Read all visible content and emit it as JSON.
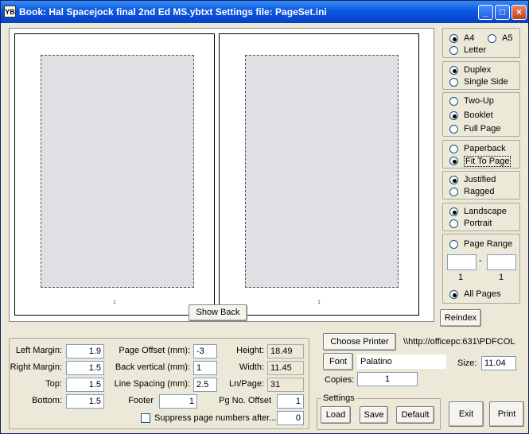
{
  "titlebar": {
    "icon": "YB",
    "title": "Book: Hal Spacejock final 2nd Ed MS.ybtxt  Settings file: PageSet.ini",
    "minimize": "_",
    "maximize": "□",
    "close": "×"
  },
  "preview": {
    "left_page_number": "1",
    "right_page_number": "1",
    "show_back_label": "Show Back"
  },
  "paper": {
    "options": [
      {
        "label": "A4",
        "selected": true
      },
      {
        "label": "A5",
        "selected": false
      },
      {
        "label": "Letter",
        "selected": false
      }
    ]
  },
  "sides": {
    "options": [
      {
        "label": "Duplex",
        "selected": true
      },
      {
        "label": "Single Side",
        "selected": false
      }
    ]
  },
  "layout": {
    "options": [
      {
        "label": "Two-Up",
        "selected": false
      },
      {
        "label": "Booklet",
        "selected": true
      },
      {
        "label": "Full Page",
        "selected": false
      }
    ]
  },
  "fit": {
    "options": [
      {
        "label": "Paperback",
        "selected": false
      },
      {
        "label": "Fit To Page",
        "selected": true
      }
    ]
  },
  "justify": {
    "options": [
      {
        "label": "Justified",
        "selected": true
      },
      {
        "label": "Ragged",
        "selected": false
      }
    ]
  },
  "orientation": {
    "options": [
      {
        "label": "Landscape",
        "selected": true
      },
      {
        "label": "Portrait",
        "selected": false
      }
    ]
  },
  "range": {
    "page_range_label": "Page Range",
    "page_range_selected": false,
    "from_value": "",
    "separator": "-",
    "to_value": "",
    "from_hint": "1",
    "to_hint": "1",
    "all_pages_label": "All Pages",
    "all_pages_selected": true
  },
  "reindex_label": "Reindex",
  "margins": {
    "left_label": "Left Margin:",
    "left_value": "1.9",
    "right_label": "Right Margin:",
    "right_value": "1.5",
    "top_label": "Top:",
    "top_value": "1.5",
    "bottom_label": "Bottom:",
    "bottom_value": "1.5"
  },
  "offsets": {
    "page_offset_label": "Page Offset (mm):",
    "page_offset_value": "-3",
    "back_vertical_label": "Back vertical (mm):",
    "back_vertical_value": "1",
    "line_spacing_label": "Line Spacing (mm):",
    "line_spacing_value": "2.5",
    "footer_label": "Footer",
    "footer_value": "1"
  },
  "metrics": {
    "height_label": "Height:",
    "height_value": "18.49",
    "width_label": "Width:",
    "width_value": "11.45",
    "lnpage_label": "Ln/Page:",
    "lnpage_value": "31",
    "pgno_offset_label": "Pg No. Offset",
    "pgno_offset_value": "1"
  },
  "suppress": {
    "label": "Suppress page numbers after...",
    "checked": false,
    "value": "0"
  },
  "printer": {
    "choose_label": "Choose Printer",
    "printer_name": "\\\\http://officepc:631\\PDFCOL",
    "font_button": "Font",
    "font_name": "Palatino",
    "size_label": "Size:",
    "size_value": "11.04",
    "copies_label": "Copies:",
    "copies_value": "1"
  },
  "settings": {
    "group_label": "Settings",
    "load_label": "Load",
    "save_label": "Save",
    "default_label": "Default"
  },
  "exit_label": "Exit",
  "print_label": "Print"
}
